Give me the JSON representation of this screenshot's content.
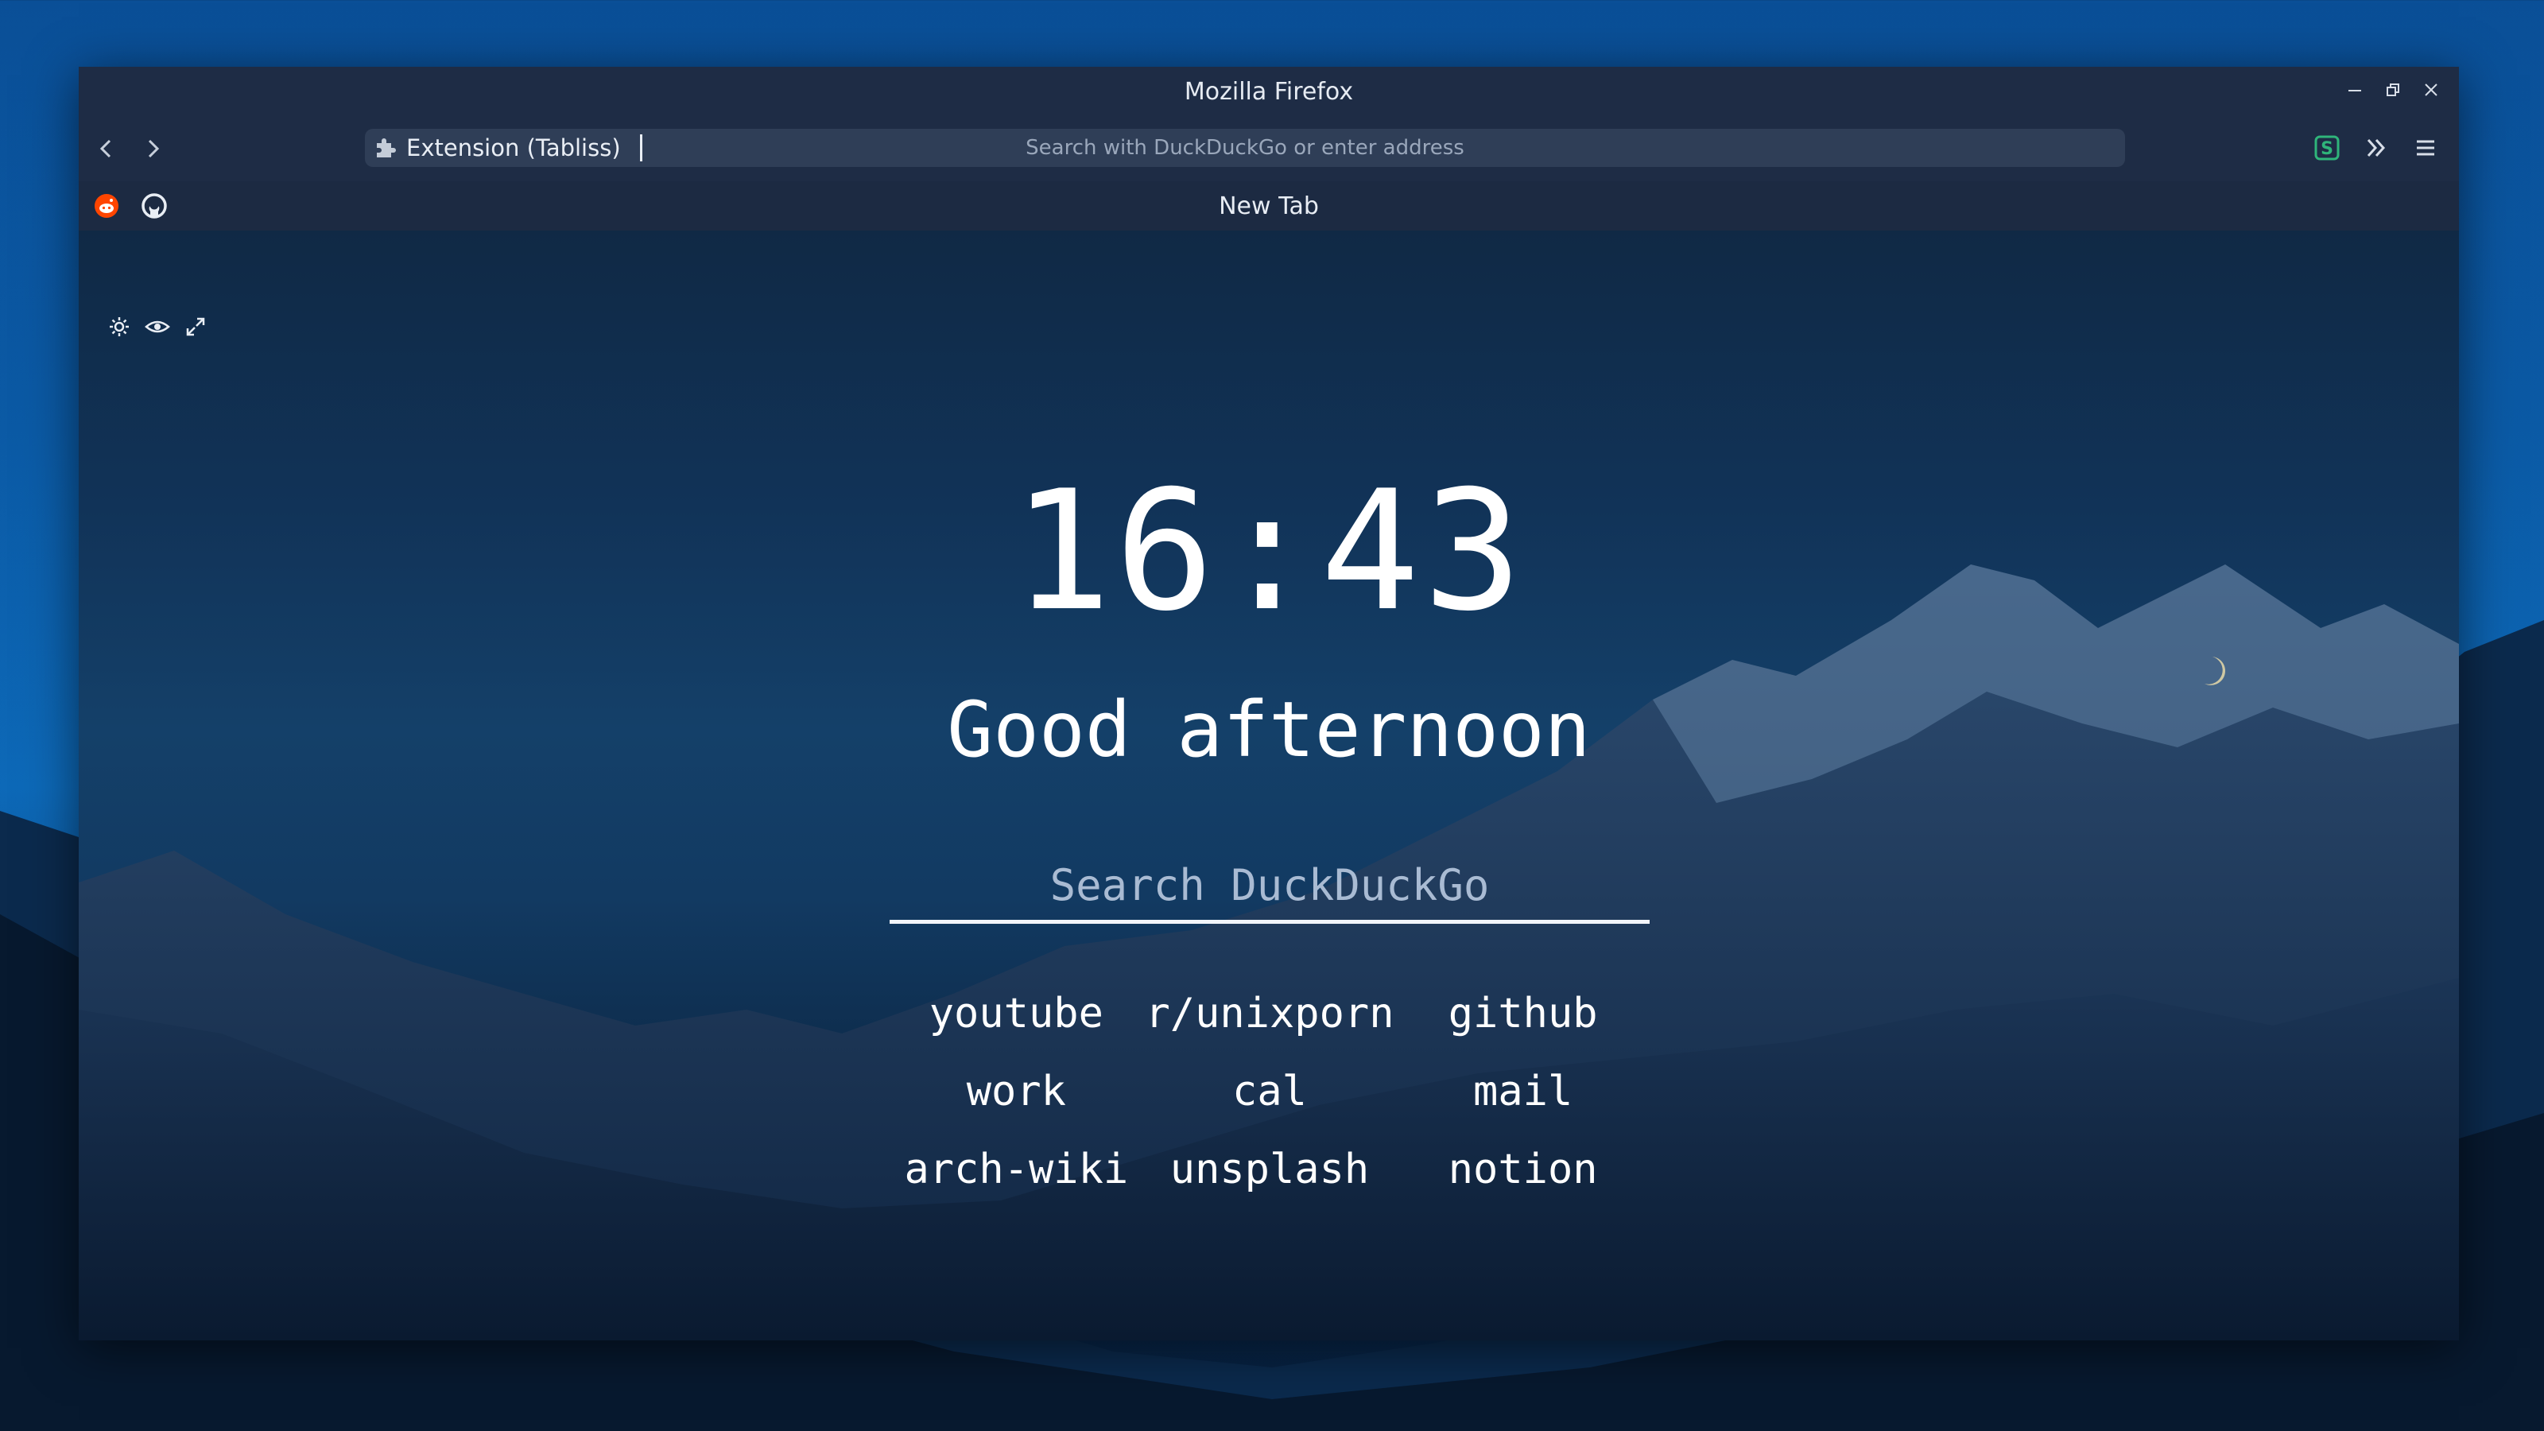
{
  "window": {
    "title": "Mozilla Firefox"
  },
  "navbar": {
    "url_identity": "Extension (Tabliss)",
    "url_placeholder": "Search with DuckDuckGo or enter address"
  },
  "tabbar": {
    "pinned": [
      "reddit-icon",
      "github-icon"
    ],
    "active_tab": "New Tab"
  },
  "newtab": {
    "clock": "16:43",
    "greeting": "Good afternoon",
    "search_placeholder": "Search DuckDuckGo",
    "links": [
      "youtube",
      "r/unixporn",
      "github",
      "work",
      "cal",
      "mail",
      "arch-wiki",
      "unsplash",
      "notion"
    ]
  },
  "colors": {
    "chrome": "#1e2c45",
    "urlbar": "#2f3e57",
    "reddit": "#ff4500",
    "extension_accent": "#2fb57a"
  }
}
